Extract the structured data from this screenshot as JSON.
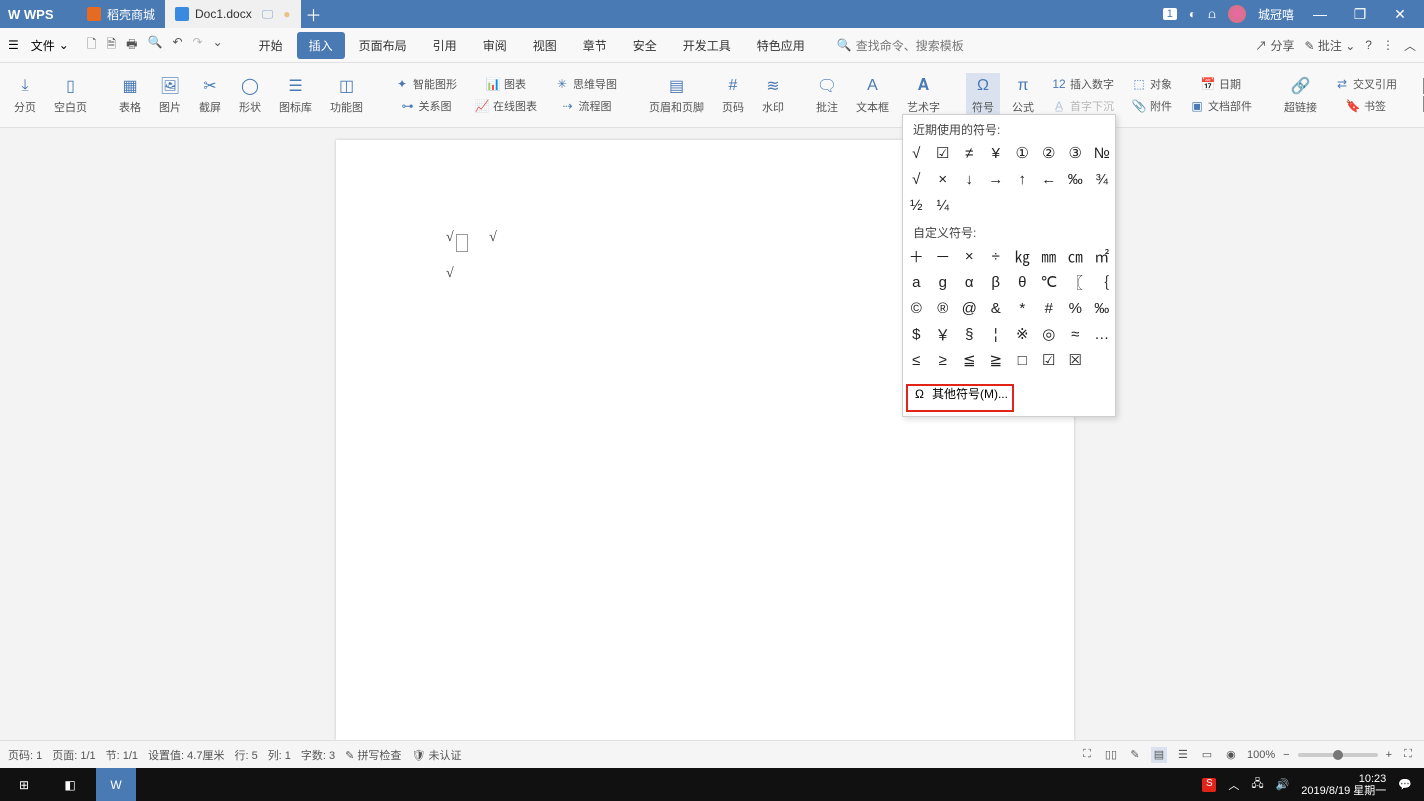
{
  "title_tabs": [
    {
      "label": "稻壳商城",
      "active": false
    },
    {
      "label": "Doc1.docx",
      "active": true
    }
  ],
  "user_name": "城冠嘻",
  "badge": "1",
  "file_menu": "文件",
  "menu_tabs": [
    "开始",
    "插入",
    "页面布局",
    "引用",
    "审阅",
    "视图",
    "章节",
    "安全",
    "开发工具",
    "特色应用"
  ],
  "menu_active_index": 1,
  "search_placeholder": "查找命令、搜索模板",
  "menubar_right": {
    "share": "分享",
    "approve": "批注"
  },
  "ribbon": {
    "r1": [
      "分页",
      "空白页",
      "表格",
      "图片",
      "截屏",
      "形状",
      "图标库",
      "功能图"
    ],
    "r2a": "智能图形",
    "r2b": "图表",
    "r2c": "思维导图",
    "r2d": "关系图",
    "r2e": "在线图表",
    "r2f": "流程图",
    "r3": [
      "页眉和页脚",
      "页码",
      "水印"
    ],
    "r4": [
      "批注",
      "文本框",
      "艺术字"
    ],
    "r5": [
      "符号",
      "公式",
      "首字下沉",
      "插入数字",
      "对象",
      "日期",
      "附件",
      "文档部件"
    ],
    "r6": [
      "超链接",
      "交叉引用",
      "书签"
    ]
  },
  "doc_content": {
    "l1": "√  √",
    "l2": "√"
  },
  "symbol_panel": {
    "recent_label": "近期使用的符号:",
    "recent": [
      "√",
      "☑",
      "≠",
      "¥",
      "①",
      "②",
      "③",
      "№",
      "√",
      "×",
      "↓",
      "→",
      "↑",
      "←",
      "‰",
      "¾",
      "½",
      "¼"
    ],
    "custom_label": "自定义符号:",
    "custom": [
      "＋",
      "－",
      "×",
      "÷",
      "㎏",
      "㎜",
      "㎝",
      "㎡",
      "a",
      "g",
      "α",
      "β",
      "θ",
      "℃",
      "〖",
      "｛",
      "©",
      "®",
      "@",
      "&",
      "*",
      "#",
      "%",
      "‰",
      "$",
      "￥",
      "§",
      "¦",
      "※",
      "◎",
      "≈",
      "…",
      "≤",
      "≥",
      "≦",
      "≧",
      "□",
      "☑",
      "☒"
    ],
    "more_label": "其他符号(M)..."
  },
  "status": {
    "page_no": "页码: 1",
    "pages": "页面: 1/1",
    "section": "节: 1/1",
    "setting": "设置值: 4.7厘米",
    "line": "行: 5",
    "col": "列: 1",
    "chars": "字数: 3",
    "spell": "拼写检查",
    "cert": "未认证",
    "zoom": "100%"
  },
  "clock": {
    "time": "10:23",
    "date": "2019/8/19 星期一"
  }
}
